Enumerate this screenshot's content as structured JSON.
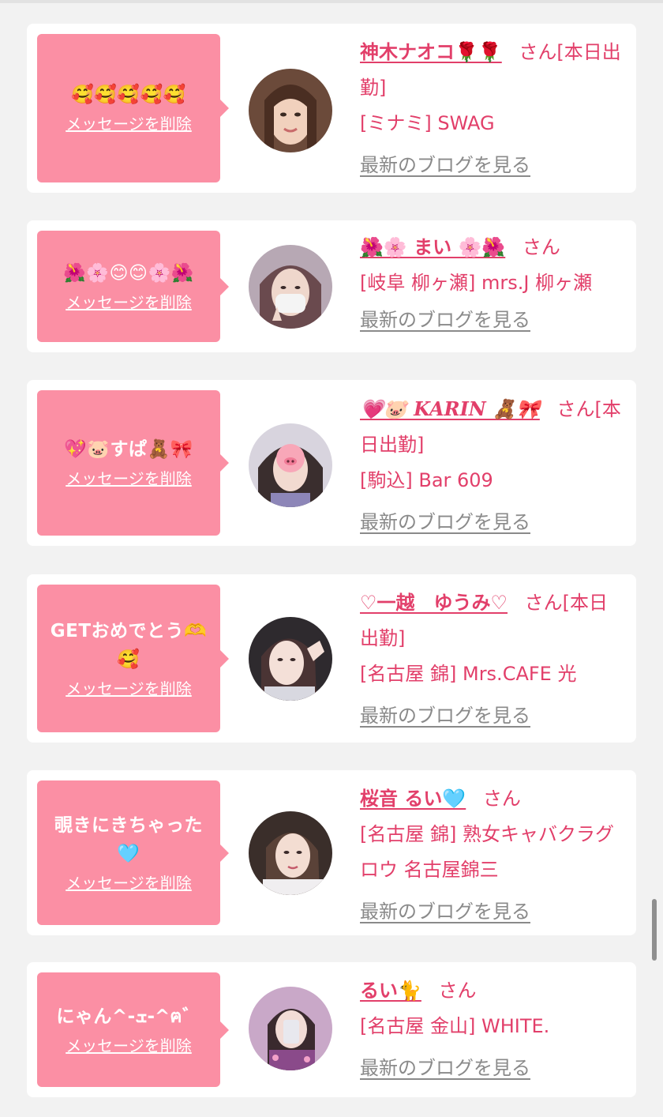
{
  "delete_label": "メッセージを削除",
  "blog_label": "最新のブログを見る",
  "messages": [
    {
      "text": "🥰🥰🥰🥰🥰",
      "name": "神木ナオコ🌹🌹",
      "san": "さん",
      "status": "[本日出勤]",
      "shop": "[ミナミ] SWAG"
    },
    {
      "text": "🌺🌸😊😊🌸🌺",
      "name": "🌺🌸 まい 🌸🌺",
      "san": "さん",
      "status": "",
      "shop": "[岐阜 柳ヶ瀬] mrs.J 柳ヶ瀬"
    },
    {
      "text": "💖🐷すぱ🧸🎀",
      "name": "💗🐷 KARIN 🧸🎀",
      "san": "さん",
      "status": "[本日出勤]",
      "shop": "[駒込] Bar 609"
    },
    {
      "text": "GETおめでとう🫶🥰",
      "name": "♡一越　ゆうみ♡",
      "san": "さん",
      "status": "[本日出勤]",
      "shop": "[名古屋 錦] Mrs.CAFE 光"
    },
    {
      "text": "覗きにきちゃった🩵",
      "name": "桜音 るい🩵",
      "san": "さん",
      "status": "",
      "shop": "[名古屋 錦] 熟女キャバクラグロウ 名古屋錦三"
    },
    {
      "text": "にゃん^-ܫ-^ฅ゛",
      "name": "るい🐈",
      "san": "さん",
      "status": "",
      "shop": "[名古屋 金山] WHITE."
    }
  ],
  "colors": {
    "bubble": "#fb8fa4",
    "accent": "#e23f6a",
    "link_gray": "#8a8a8a",
    "background": "#f2f2f2"
  }
}
